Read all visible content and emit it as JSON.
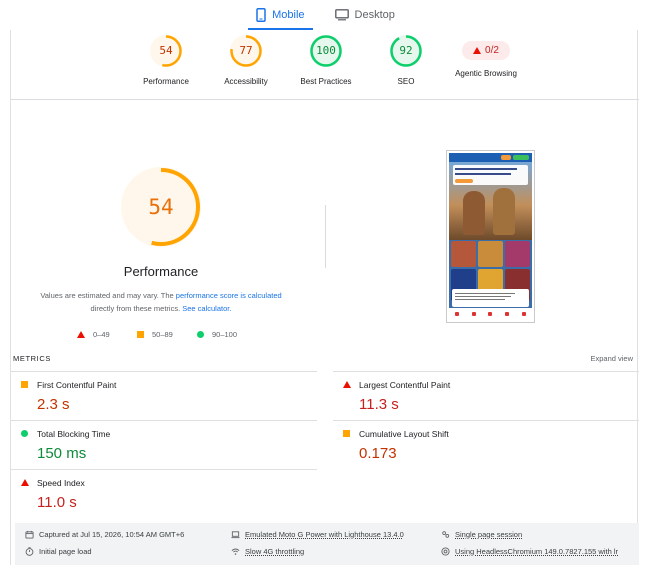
{
  "device_tabs": [
    {
      "label": "Mobile",
      "active": true,
      "icon": "phone-icon"
    },
    {
      "label": "Desktop",
      "active": false,
      "icon": "monitor-icon"
    }
  ],
  "categories": [
    {
      "label": "Performance",
      "score": "54",
      "status": "average"
    },
    {
      "label": "Accessibility",
      "score": "77",
      "status": "average"
    },
    {
      "label": "Best Practices",
      "score": "100",
      "status": "pass"
    },
    {
      "label": "SEO",
      "score": "92",
      "status": "pass"
    },
    {
      "label": "Agentic Browsing",
      "score": "0/2",
      "status": "fail"
    }
  ],
  "summary": {
    "score": "54",
    "score_fraction": 0.54,
    "title": "Performance",
    "note_part1": "Values are estimated and may vary. The ",
    "note_link1": "performance score is calculated",
    "note_part2": " directly from these metrics. ",
    "note_link2": "See calculator."
  },
  "legend": [
    {
      "range": "0–49",
      "shape": "triangle",
      "color": "#eb0f00"
    },
    {
      "range": "50–89",
      "shape": "square",
      "color": "#ffa400"
    },
    {
      "range": "90–100",
      "shape": "circle",
      "color": "#0cce6b"
    }
  ],
  "metrics": {
    "title": "METRICS",
    "expand_label": "Expand view",
    "items": [
      {
        "name": "First Contentful Paint",
        "value": "2.3 s",
        "status": "average"
      },
      {
        "name": "Largest Contentful Paint",
        "value": "11.3 s",
        "status": "fail"
      },
      {
        "name": "Total Blocking Time",
        "value": "150 ms",
        "status": "pass"
      },
      {
        "name": "Cumulative Layout Shift",
        "value": "0.173",
        "status": "average"
      },
      {
        "name": "Speed Index",
        "value": "11.0 s",
        "status": "fail"
      }
    ]
  },
  "runtime": {
    "captured": "Captured at Jul 15, 2026, 10:54 AM GMT+6",
    "load": "Initial page load",
    "device": "Emulated Moto G Power with Lighthouse 13.4.0",
    "throttling": "Slow 4G throttling",
    "session": "Single page session",
    "browser": "Using HeadlessChromium 149.0.7827.155 with lr"
  },
  "colors": {
    "accent": "#1a73e8",
    "average": "#ffa400",
    "pass": "#0cce6b",
    "fail": "#eb0f00"
  }
}
